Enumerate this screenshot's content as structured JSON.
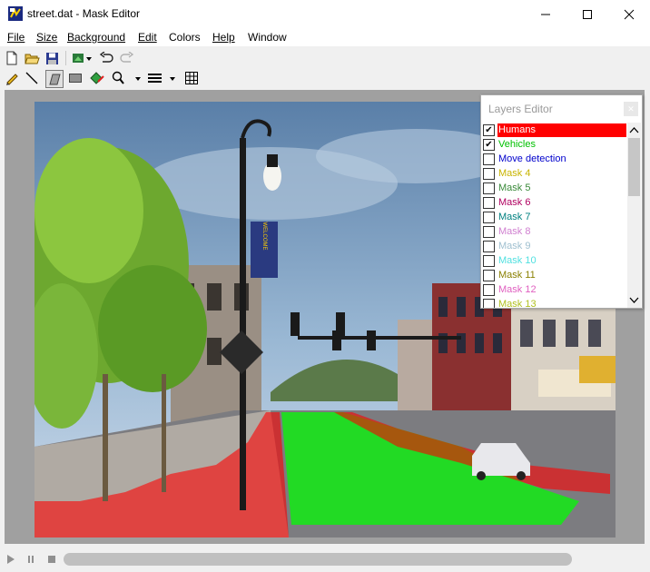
{
  "window": {
    "title": "street.dat - Mask Editor"
  },
  "menu": [
    "File",
    "Size",
    "Background",
    "Edit",
    "Colors",
    "Help",
    "Window"
  ],
  "toolbar_row1": [
    "new-file-icon",
    "open-folder-icon",
    "save-disk-icon",
    "import-mask-icon",
    "undo-icon",
    "redo-icon"
  ],
  "toolbar_row2": [
    "pencil-icon",
    "line-icon",
    "polygon-icon",
    "rectangle-icon",
    "fill-icon",
    "zoom-icon",
    "line-width-icon",
    "grid-icon"
  ],
  "layers_editor": {
    "title": "Layers Editor",
    "layers": [
      {
        "name": "Humans",
        "checked": true,
        "color": "#ff0000",
        "selected": true
      },
      {
        "name": "Vehicles",
        "checked": true,
        "color": "#00c000"
      },
      {
        "name": "Move detection",
        "checked": false,
        "color": "#0000cc"
      },
      {
        "name": "Mask 4",
        "checked": false,
        "color": "#c8b400"
      },
      {
        "name": "Mask 5",
        "checked": false,
        "color": "#3a8a3a"
      },
      {
        "name": "Mask 6",
        "checked": false,
        "color": "#b00060"
      },
      {
        "name": "Mask 7",
        "checked": false,
        "color": "#008080"
      },
      {
        "name": "Mask 8",
        "checked": false,
        "color": "#d080d0"
      },
      {
        "name": "Mask 9",
        "checked": false,
        "color": "#a0c0d0"
      },
      {
        "name": "Mask 10",
        "checked": false,
        "color": "#50e0e0"
      },
      {
        "name": "Mask 11",
        "checked": false,
        "color": "#8a8000"
      },
      {
        "name": "Mask 12",
        "checked": false,
        "color": "#e060c0"
      },
      {
        "name": "Mask 13",
        "checked": false,
        "color": "#b0c020"
      }
    ]
  },
  "masks": {
    "humans_color": "#ff0000",
    "vehicles_color": "#00ff00"
  },
  "banner_text": "WELCOME"
}
